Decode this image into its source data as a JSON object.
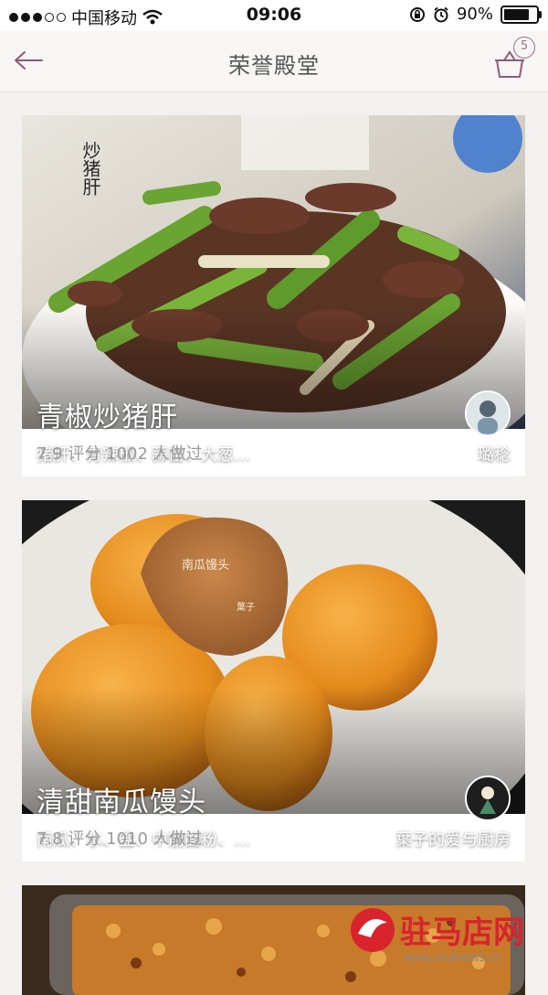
{
  "status_bar": {
    "carrier": "中国移动",
    "time": "09:06",
    "battery_percent": "90%",
    "battery_level": 0.9
  },
  "nav": {
    "title": "荣誉殿堂",
    "basket_count": "5",
    "accent_color": "#8c5a78"
  },
  "recipes": [
    {
      "title": "青椒炒猪肝",
      "ingredients": "猪肝、青辣椒、蒜苗、大葱…",
      "author": "璐稔",
      "score": "7.9",
      "score_label": "评分",
      "made_count": "1002",
      "made_label": "人做过",
      "image_caption": "炒猪肝"
    },
    {
      "title": "清甜南瓜馒头",
      "ingredients": "南瓜、水、盐、中筋面粉、…",
      "author": "葉子的爱与厨房",
      "score": "7.8",
      "score_label": "评分",
      "made_count": "1010",
      "made_label": "人做过",
      "image_caption": "南瓜馒头",
      "image_caption_small": "葉子"
    }
  ],
  "watermark": {
    "text": "驻马店网",
    "url": "www.zmdnews.cn"
  }
}
